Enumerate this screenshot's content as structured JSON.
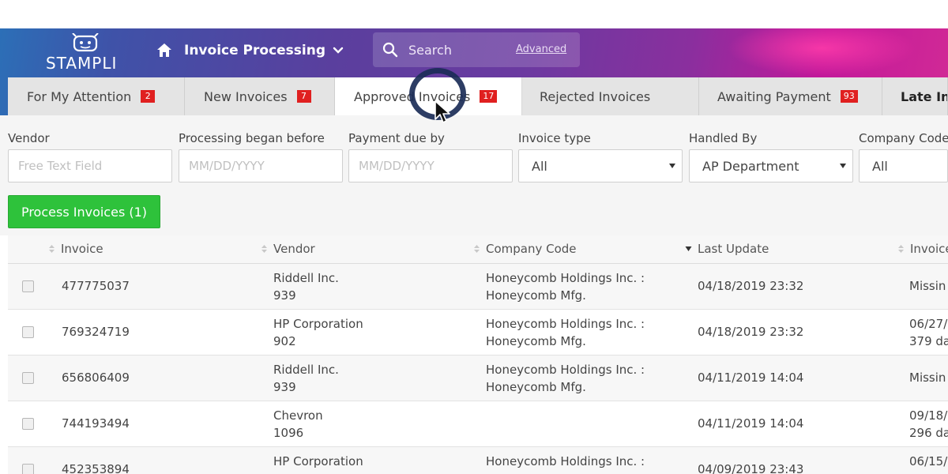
{
  "app": {
    "logo_text": "STAMPLI",
    "module_title": "Invoice Processing",
    "search_placeholder": "Search",
    "search_advanced": "Advanced"
  },
  "tabs": [
    {
      "label": "For My Attention",
      "count": "2"
    },
    {
      "label": "New Invoices",
      "count": "7"
    },
    {
      "label": "Approved Invoices",
      "count": "17",
      "active": true
    },
    {
      "label": "Rejected Invoices",
      "count": ""
    },
    {
      "label": "Awaiting Payment",
      "count": "93"
    },
    {
      "label": "Late In",
      "count": ""
    }
  ],
  "filters": {
    "vendor": {
      "label": "Vendor",
      "placeholder": "Free Text Field"
    },
    "processing_began_before": {
      "label": "Processing began before",
      "placeholder": "MM/DD/YYYY"
    },
    "payment_due_by": {
      "label": "Payment due by",
      "placeholder": "MM/DD/YYYY"
    },
    "invoice_type": {
      "label": "Invoice type",
      "value": "All"
    },
    "handled_by": {
      "label": "Handled By",
      "value": "AP Department"
    },
    "company_code": {
      "label": "Company Code",
      "value": "All"
    }
  },
  "actions": {
    "process_label": "Process Invoices (1)"
  },
  "table": {
    "columns": [
      "Invoice",
      "Vendor",
      "Company Code",
      "Last Update",
      "Invoice"
    ],
    "rows": [
      {
        "invoice": "477775037",
        "vendor": "Riddell Inc.",
        "vendor_id": "939",
        "company1": "Honeycomb Holdings Inc. :",
        "company2": "Honeycomb Mfg.",
        "last_update": "04/18/2019 23:32",
        "due1": "Missin",
        "due2": ""
      },
      {
        "invoice": "769324719",
        "vendor": "HP Corporation",
        "vendor_id": "902",
        "company1": "Honeycomb Holdings Inc. :",
        "company2": "Honeycomb Mfg.",
        "last_update": "04/18/2019 23:32",
        "due1": "06/27/",
        "due2": "379 da"
      },
      {
        "invoice": "656806409",
        "vendor": "Riddell Inc.",
        "vendor_id": "939",
        "company1": "Honeycomb Holdings Inc. :",
        "company2": "Honeycomb Mfg.",
        "last_update": "04/11/2019 14:04",
        "due1": "Missin",
        "due2": ""
      },
      {
        "invoice": "744193494",
        "vendor": "Chevron",
        "vendor_id": "1096",
        "company1": "",
        "company2": "",
        "last_update": "04/11/2019 14:04",
        "due1": "09/18/",
        "due2": "296 da"
      },
      {
        "invoice": "452353894",
        "vendor": "HP Corporation",
        "vendor_id": "",
        "company1": "Honeycomb Holdings Inc. :",
        "company2": "",
        "last_update": "04/09/2019 23:43",
        "due1": "06/15/",
        "due2": ""
      }
    ]
  },
  "colors": {
    "accent_green": "#2ec23b",
    "badge_red": "#e02020",
    "header_start": "#2c6fb7",
    "header_end": "#d12a96"
  },
  "icons": [
    "home-icon",
    "chevron-down-icon",
    "search-icon",
    "robot-logo-icon",
    "sort-icon",
    "mouse-pointer-icon"
  ]
}
